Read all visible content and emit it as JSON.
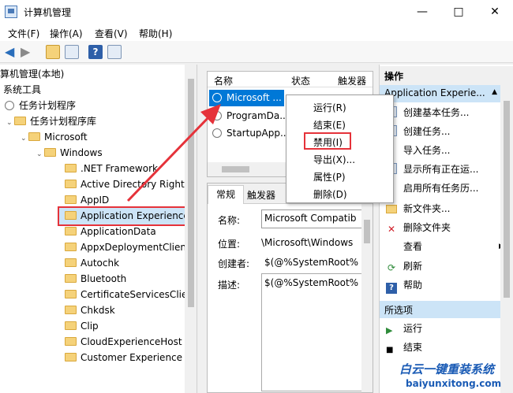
{
  "window": {
    "title": "计算机管理",
    "min": "—",
    "max": "□",
    "close": "✕"
  },
  "menu": [
    "文件(F)",
    "操作(A)",
    "查看(V)",
    "帮助(H)"
  ],
  "tree": {
    "root": "算机管理(本地)",
    "items": [
      {
        "label": "系统工具"
      },
      {
        "label": "任务计划程序"
      },
      {
        "label": "任务计划程序库"
      },
      {
        "label": "Microsoft"
      },
      {
        "label": "Windows"
      },
      {
        "label": ".NET Framework"
      },
      {
        "label": "Active Directory Rights"
      },
      {
        "label": "AppID"
      },
      {
        "label": "Application Experience"
      },
      {
        "label": "ApplicationData"
      },
      {
        "label": "AppxDeploymentClient"
      },
      {
        "label": "Autochk"
      },
      {
        "label": "Bluetooth"
      },
      {
        "label": "CertificateServicesClien"
      },
      {
        "label": "Chkdsk"
      },
      {
        "label": "Clip"
      },
      {
        "label": "CloudExperienceHost"
      },
      {
        "label": "Customer Experience Im"
      }
    ]
  },
  "tasks": {
    "columns": [
      "名称",
      "状态",
      "触发器"
    ],
    "rows": [
      {
        "name": "Microsoft ..."
      },
      {
        "name": "ProgramDa..."
      },
      {
        "name": "StartupApp..."
      }
    ]
  },
  "details": {
    "tabs": [
      "常规",
      "触发器"
    ],
    "fields": [
      {
        "label": "名称:",
        "value": "Microsoft Compatib"
      },
      {
        "label": "位置:",
        "value": "\\Microsoft\\Windows"
      },
      {
        "label": "创建者:",
        "value": "$(@%SystemRoot%"
      },
      {
        "label": "描述:",
        "value": "$(@%SystemRoot%"
      }
    ]
  },
  "context_menu": [
    "运行(R)",
    "结束(E)",
    "禁用(I)",
    "导出(X)...",
    "属性(P)",
    "删除(D)"
  ],
  "actions": {
    "header": "操作",
    "section1": "Application Experie...",
    "items1": [
      "创建基本任务...",
      "创建任务...",
      "导入任务...",
      "显示所有正在运...",
      "启用所有任务历...",
      "新文件夹...",
      "删除文件夹",
      "查看",
      "刷新",
      "帮助"
    ],
    "section2": "所选项",
    "items2": [
      "运行",
      "结束"
    ]
  },
  "watermark": {
    "text": "白云一键重装系统",
    "url": "baiyunxitong.com"
  }
}
